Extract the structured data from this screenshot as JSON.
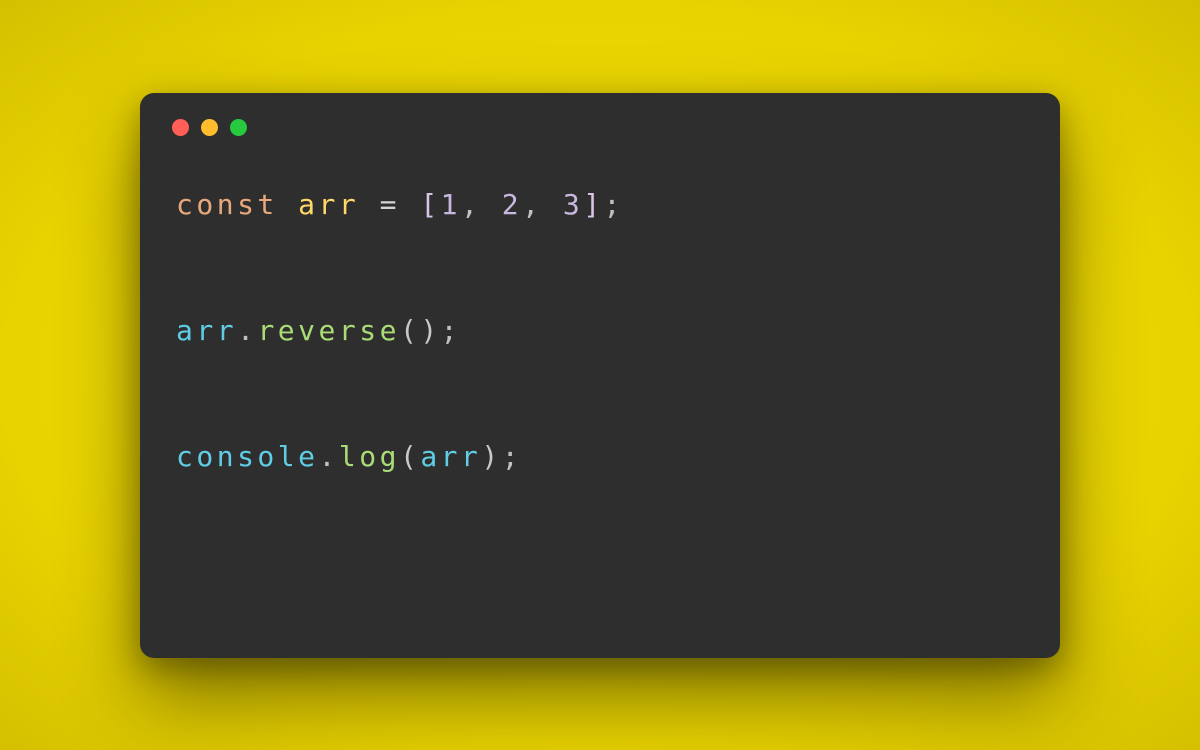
{
  "window": {
    "traffic_lights": [
      "close",
      "minimize",
      "maximize"
    ]
  },
  "code": {
    "line1": {
      "keyword": "const",
      "space1": " ",
      "varname": "arr",
      "space2": " ",
      "equals": "=",
      "space3": " ",
      "lbracket": "[",
      "n1": "1",
      "comma1": ",",
      "space4": " ",
      "n2": "2",
      "comma2": ",",
      "space5": " ",
      "n3": "3",
      "rbracket": "]",
      "semi": ";"
    },
    "line2": {
      "obj": "arr",
      "dot": ".",
      "method": "reverse",
      "lparen": "(",
      "rparen": ")",
      "semi": ";"
    },
    "line3": {
      "obj": "console",
      "dot": ".",
      "method": "log",
      "lparen": "(",
      "arg": "arr",
      "rparen": ")",
      "semi": ";"
    }
  }
}
